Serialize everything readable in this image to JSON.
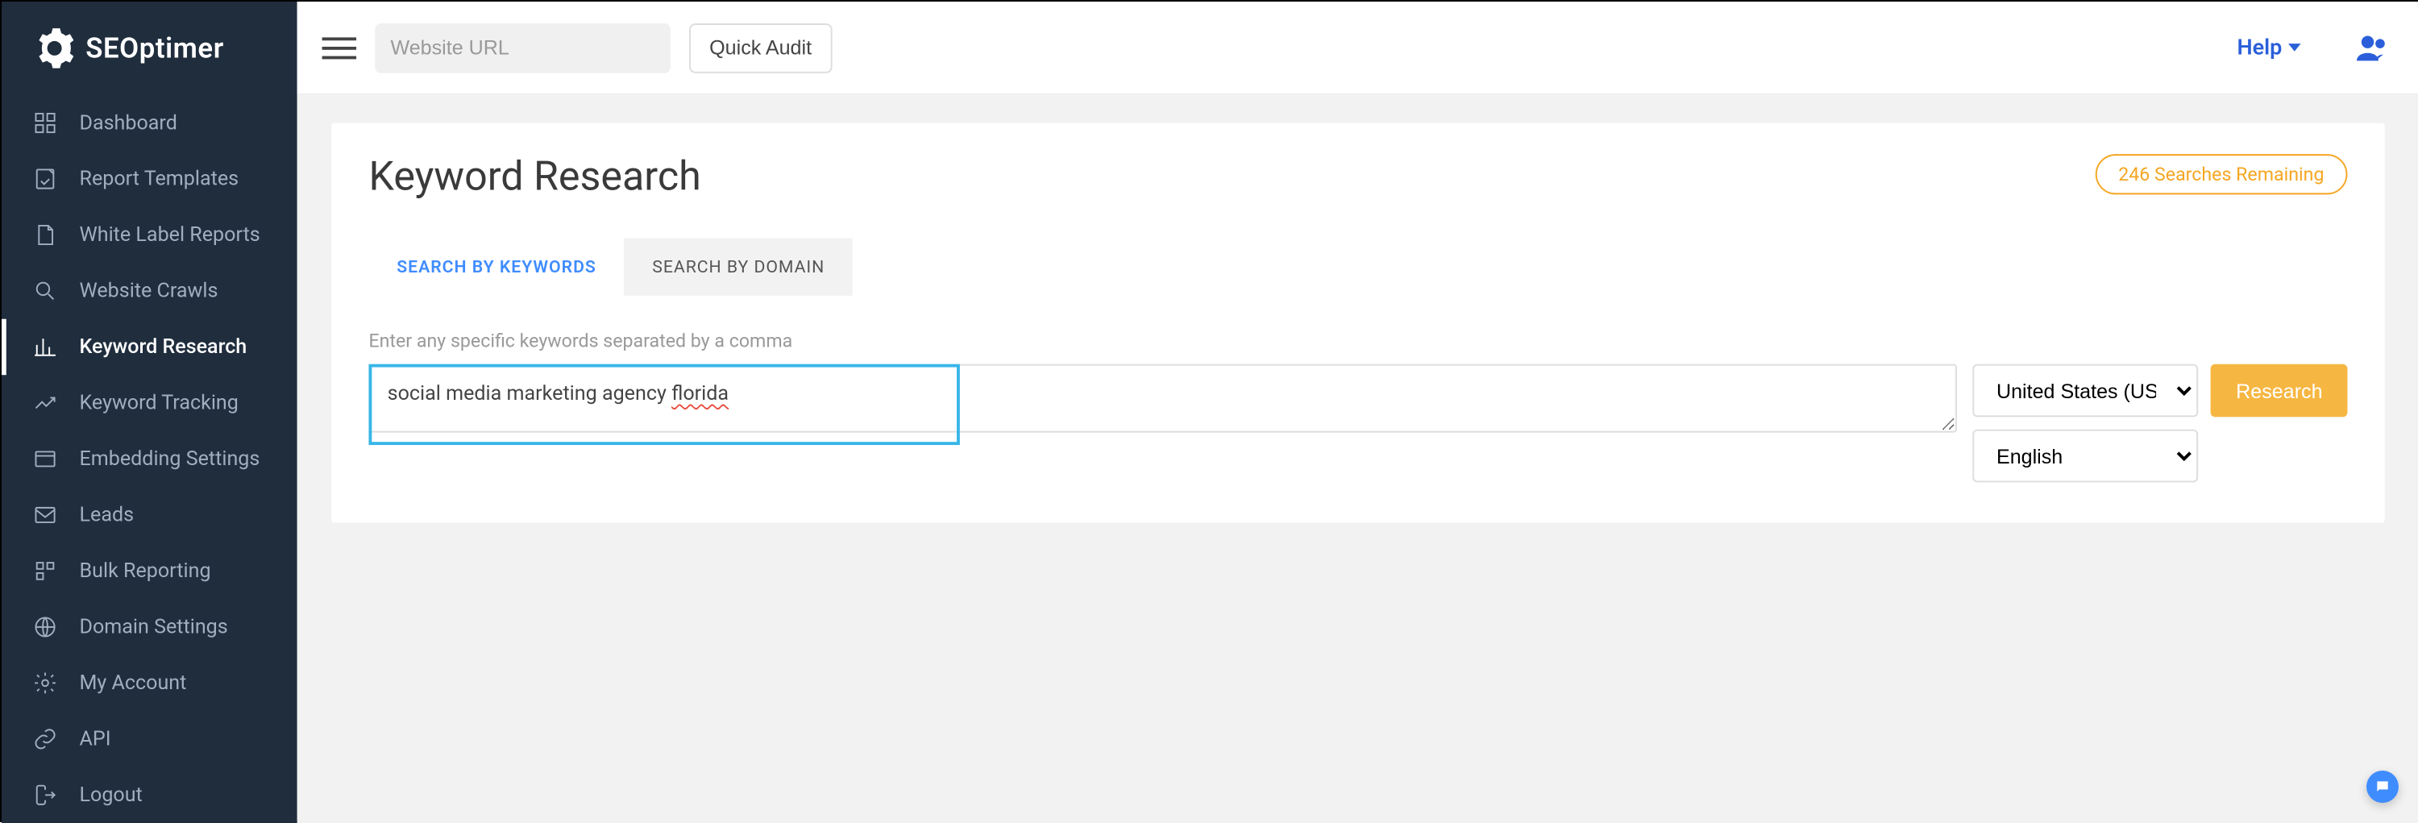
{
  "brand": "SEOptimer",
  "topbar": {
    "url_placeholder": "Website URL",
    "quick_audit": "Quick Audit",
    "help": "Help"
  },
  "sidebar": {
    "items": [
      {
        "label": "Dashboard",
        "icon": "dashboard-icon"
      },
      {
        "label": "Report Templates",
        "icon": "template-icon"
      },
      {
        "label": "White Label Reports",
        "icon": "file-icon"
      },
      {
        "label": "Website Crawls",
        "icon": "magnify-icon"
      },
      {
        "label": "Keyword Research",
        "icon": "chart-icon",
        "active": true
      },
      {
        "label": "Keyword Tracking",
        "icon": "trend-icon"
      },
      {
        "label": "Embedding Settings",
        "icon": "embed-icon"
      },
      {
        "label": "Leads",
        "icon": "mail-icon"
      },
      {
        "label": "Bulk Reporting",
        "icon": "grid-icon"
      },
      {
        "label": "Domain Settings",
        "icon": "globe-icon"
      },
      {
        "label": "My Account",
        "icon": "gear-icon"
      },
      {
        "label": "API",
        "icon": "link-icon"
      },
      {
        "label": "Logout",
        "icon": "logout-icon"
      }
    ]
  },
  "page": {
    "title": "Keyword Research",
    "remaining": "246 Searches Remaining",
    "tabs": {
      "keywords": "SEARCH BY KEYWORDS",
      "domain": "SEARCH BY DOMAIN"
    },
    "instruction": "Enter any specific keywords separated by a comma",
    "keyword_value_prefix": "social media marketing agency ",
    "keyword_value_squiggle": "florida",
    "country_selected": "United States (US)",
    "language_selected": "English",
    "research_btn": "Research"
  }
}
